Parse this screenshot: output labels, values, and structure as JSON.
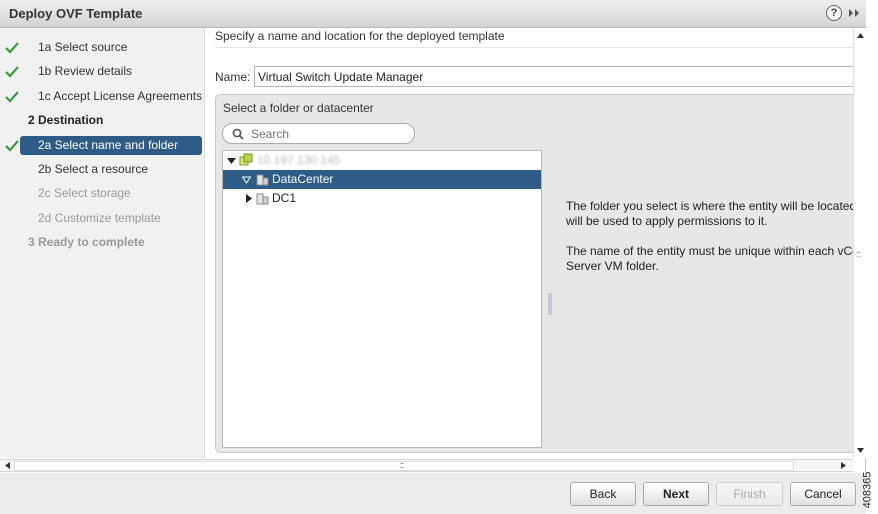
{
  "window": {
    "title": "Deploy OVF Template"
  },
  "steps": [
    {
      "label": "1a  Select source",
      "state": "done"
    },
    {
      "label": "1b  Review details",
      "state": "done"
    },
    {
      "label": "1c  Accept License Agreements",
      "state": "done"
    },
    {
      "label": "2  Destination",
      "state": "header"
    },
    {
      "label": "2a  Select name and folder",
      "state": "selected"
    },
    {
      "label": "2b  Select a resource",
      "state": "todo"
    },
    {
      "label": "2c  Select storage",
      "state": "disabled"
    },
    {
      "label": "2d  Customize template",
      "state": "disabled"
    },
    {
      "label": "3  Ready to complete",
      "state": "header-disabled"
    }
  ],
  "main": {
    "title": "Specify a name and location for the deployed template",
    "name_label": "Name:",
    "name_value": "Virtual Switch Update Manager",
    "folder_title": "Select a folder or datacenter",
    "search_placeholder": "Search",
    "tree": [
      {
        "label": "10.197.130.145",
        "level": 0,
        "expanded": true,
        "icon": "vcenter-icon",
        "blurred": true
      },
      {
        "label": "DataCenter",
        "level": 1,
        "expanded": true,
        "icon": "datacenter-icon",
        "selected": true
      },
      {
        "label": "DC1",
        "level": 1,
        "expanded": false,
        "icon": "datacenter-icon"
      }
    ],
    "info": [
      "The folder you select is where the entity will be located, a",
      "will be used to apply permissions to it.",
      "The name of the entity must be unique within each vCente",
      "Server VM folder."
    ]
  },
  "footer": {
    "back": "Back",
    "next": "Next",
    "finish": "Finish",
    "cancel": "Cancel"
  },
  "figure_id": "408365",
  "colors": {
    "selected_bg": "#2e5c86",
    "check_green": "#3c9a3c"
  }
}
